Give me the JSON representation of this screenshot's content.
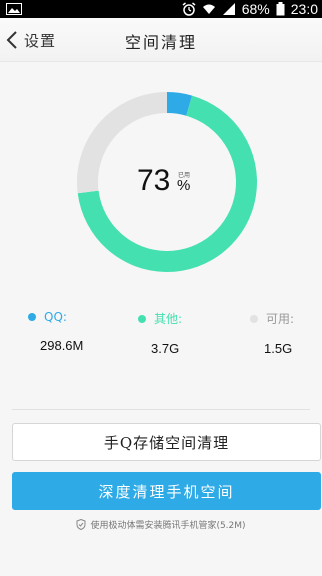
{
  "status_bar": {
    "battery": "68%",
    "time": "23:0",
    "icons": [
      "image-icon",
      "alarm-icon",
      "wifi-icon",
      "signal-icon",
      "battery-icon"
    ]
  },
  "header": {
    "back_label": "设置",
    "title": "空间清理"
  },
  "donut": {
    "percent": "73",
    "used_label": "已用",
    "percent_sign": "%",
    "segments": [
      {
        "name": "QQ",
        "fraction": 0.045,
        "color": "#2eaae6"
      },
      {
        "name": "其他",
        "fraction": 0.685,
        "color": "#44e0b0"
      },
      {
        "name": "可用",
        "fraction": 0.27,
        "color": "#e2e2e2"
      }
    ]
  },
  "legend": [
    {
      "label": "QQ:",
      "value": "298.6M",
      "color": "#2eaae6"
    },
    {
      "label": "其他:",
      "value": "3.7G",
      "color": "#44e0b0"
    },
    {
      "label": "可用:",
      "value": "1.5G",
      "color": "#e2e2e2"
    }
  ],
  "buttons": {
    "storage_clean": "手Q存储空间清理",
    "deep_clean": "深度清理手机空间"
  },
  "footer": {
    "text": "使用极动体需安装腾讯手机管家(5.2M)"
  }
}
